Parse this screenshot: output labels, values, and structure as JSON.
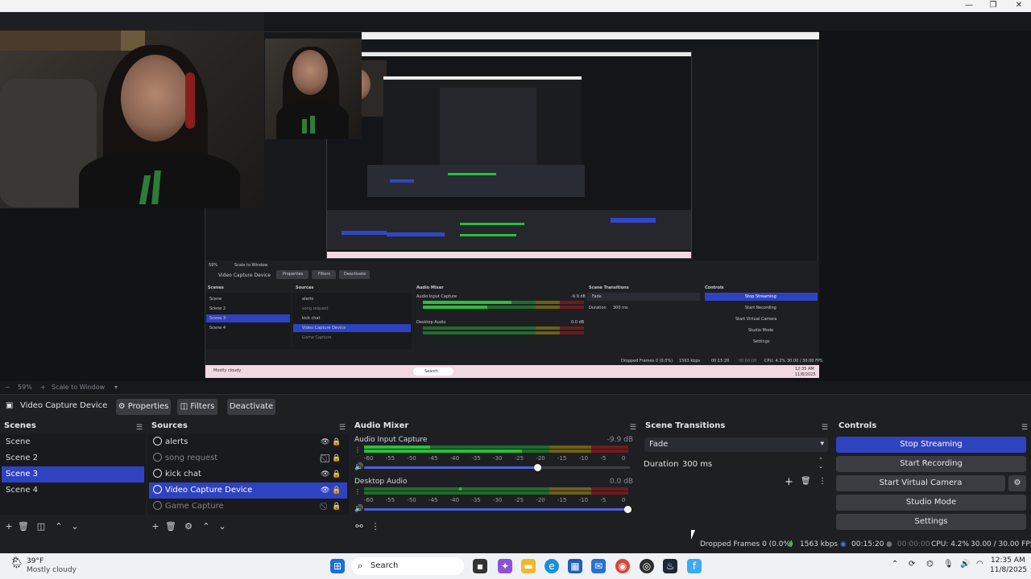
{
  "window": {
    "minimize": "—",
    "maximize": "❐",
    "close": "✕"
  },
  "preview": {
    "zoom": "59%",
    "scale_mode": "Scale to Window",
    "nested": {
      "source": "Video Capture Device",
      "properties": "Properties",
      "filters": "Filters",
      "deactivate": "Deactivate",
      "scenes_header": "Scenes",
      "sources_header": "Sources",
      "mixer_header": "Audio Mixer",
      "transitions_header": "Scene Transitions",
      "controls_header": "Controls",
      "scenes": [
        "Scene",
        "Scene 2",
        "Scene 3",
        "Scene 4"
      ],
      "sources": [
        "alerts",
        "song request",
        "kick chat",
        "Video Capture Device",
        "Game Capture"
      ],
      "stop_streaming": "Stop Streaming",
      "start_recording": "Start Recording",
      "start_virtual_camera": "Start Virtual Camera",
      "studio_mode": "Studio Mode",
      "settings": "Settings",
      "fade": "Fade",
      "duration": "Duration",
      "duration_value": "300 ms",
      "zoom": "59%",
      "scale_mode": "Scale to Window",
      "audio_input": "Audio Input Capture",
      "desktop_audio": "Desktop Audio",
      "db1": "-9.9 dB",
      "db2": "0.0 dB",
      "dropped": "Dropped Frames 0 (0.0%)",
      "kbps": "1563 kbps",
      "time": "00:15:20",
      "rec_time": "00:00:00",
      "cpu": "CPU: 4.2%",
      "fps": "30.00 / 30.00 FPS",
      "weather": "Mostly cloudy",
      "search": "Search",
      "clock": "12:35 AM",
      "date": "11/8/2025"
    }
  },
  "source_toolbar": {
    "source_name": "Video Capture Device",
    "properties": "Properties",
    "filters": "Filters",
    "deactivate": "Deactivate"
  },
  "scenes": {
    "title": "Scenes",
    "items": [
      "Scene",
      "Scene 2",
      "Scene 3",
      "Scene 4"
    ],
    "selected_index": 2
  },
  "sources": {
    "title": "Sources",
    "items": [
      {
        "label": "alerts",
        "visible": true,
        "locked": true,
        "dim": false
      },
      {
        "label": "song request",
        "visible": false,
        "locked": true,
        "dim": true
      },
      {
        "label": "kick chat",
        "visible": true,
        "locked": true,
        "dim": false
      },
      {
        "label": "Video Capture Device",
        "visible": true,
        "locked": true,
        "dim": false,
        "selected": true
      },
      {
        "label": "Game Capture",
        "visible": false,
        "locked": true,
        "dim": true
      }
    ]
  },
  "mixer": {
    "title": "Audio Mixer",
    "tracks": [
      {
        "name": "Audio Input Capture",
        "db": "-9.9 dB",
        "volume": 0.66
      },
      {
        "name": "Desktop Audio",
        "db": "0.0 dB",
        "volume": 1.0
      }
    ],
    "scale": [
      "-60",
      "-55",
      "-50",
      "-45",
      "-40",
      "-35",
      "-30",
      "-25",
      "-20",
      "-15",
      "-10",
      "-5",
      "0"
    ]
  },
  "transitions": {
    "title": "Scene Transitions",
    "selected": "Fade",
    "duration_label": "Duration",
    "duration_value": "300 ms"
  },
  "controls": {
    "title": "Controls",
    "stop_streaming": "Stop Streaming",
    "start_recording": "Start Recording",
    "start_virtual_camera": "Start Virtual Camera",
    "studio_mode": "Studio Mode",
    "settings": "Settings"
  },
  "status": {
    "dropped": "Dropped Frames 0 (0.0%)",
    "kbps": "1563 kbps",
    "stream_time": "00:15:20",
    "rec_time": "00:00:00",
    "cpu": "CPU: 4.2%",
    "fps": "30.00 / 30.00 FPS"
  },
  "taskbar": {
    "temperature": "39°F",
    "weather": "Mostly cloudy",
    "search": "Search",
    "time": "12:35 AM",
    "date": "11/8/2025"
  },
  "colors": {
    "accent": "#2f43c0",
    "meter_green": "#2bbd3f",
    "meter_yellow": "#b5a02a",
    "meter_red": "#b1262f"
  }
}
